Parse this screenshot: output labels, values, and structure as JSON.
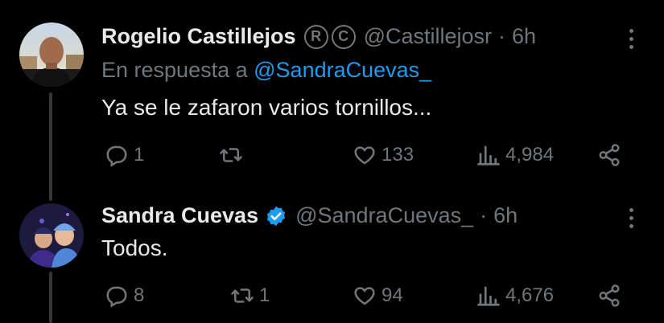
{
  "tweets": [
    {
      "author_name": "Rogelio Castillejos",
      "badges": [
        "R",
        "C"
      ],
      "handle": "@Castillejosr",
      "separator": "·",
      "time": "6h",
      "reply_prefix": "En respuesta a",
      "reply_mention": "@SandraCuevas_",
      "text": "Ya se le zafaron varios tornillos...",
      "replies": "1",
      "retweets": "",
      "likes": "133",
      "views": "4,984"
    },
    {
      "author_name": "Sandra Cuevas",
      "handle": "@SandraCuevas_",
      "separator": "·",
      "time": "6h",
      "text": "Todos.",
      "replies": "8",
      "retweets": "1",
      "likes": "94",
      "views": "4,676"
    }
  ],
  "colors": {
    "background": "#000000",
    "text": "#e7e9ea",
    "muted": "#71767b",
    "link": "#1d9bf0",
    "verified": "#1d9bf0"
  },
  "icons": [
    "reply-icon",
    "retweet-icon",
    "like-icon",
    "views-icon",
    "share-icon",
    "more-icon",
    "verified-icon"
  ]
}
